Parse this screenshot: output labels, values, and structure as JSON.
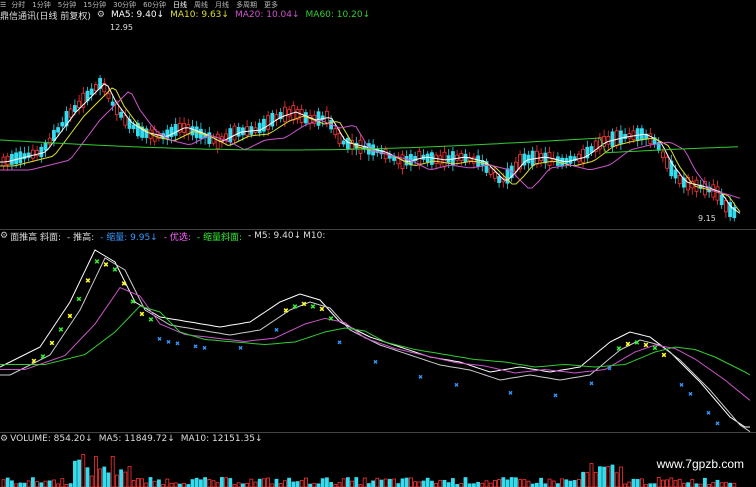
{
  "toolbar": {
    "tabs": [
      "分时",
      "1分钟",
      "5分钟",
      "15分钟",
      "30分钟",
      "60分钟",
      "日线",
      "周线",
      "月线",
      "多周期",
      "更多"
    ],
    "active_index": 6
  },
  "main_legend": {
    "title": "鼎信通讯(日线 前复权)",
    "ma5": "MA5: 9.40↓",
    "ma10": "MA10: 9.63↓",
    "ma20": "MA20: 10.04↓",
    "ma60": "MA60: 10.20↓"
  },
  "main_chart": {
    "high_label": "12.95",
    "low_label": "9.15",
    "colors": {
      "up": "#ff3333",
      "down": "#33ddee",
      "ma5": "#ffffff",
      "ma10": "#dddd33",
      "ma20": "#cc55cc",
      "ma60": "#33cc33"
    }
  },
  "indicator_legend": {
    "name": "面推高 斜面:",
    "tui_gao": "- 推高:",
    "suo_liang": "- 缩量: 9.95↓",
    "you_xuan": "- 优选:",
    "suo_liang_xie_mian": "- 缩量斜面:",
    "m5": "- M5: 9.40↓",
    "m10": "M10:"
  },
  "volume_legend": {
    "volume": "VOLUME: 854.20↓",
    "ma5": "MA5: 11849.72↓",
    "ma10": "MA10: 12151.35↓"
  },
  "watermark": "www.7gpzb.com"
}
